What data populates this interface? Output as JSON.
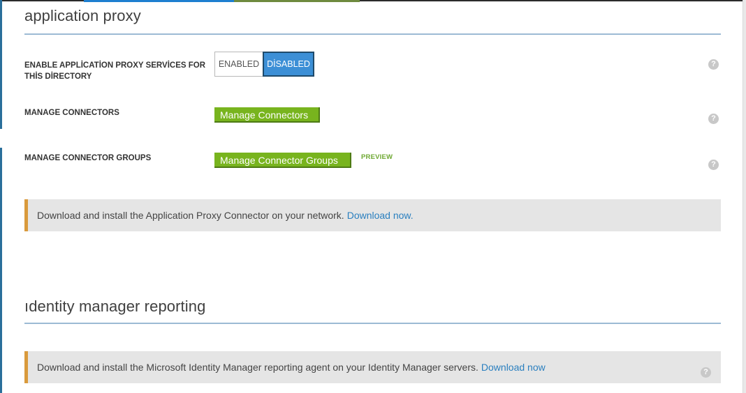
{
  "application_proxy": {
    "title": "application proxy",
    "enable_row": {
      "label": "ENABLE APPLİCATİON PROXY SERVİCES FOR THİS DİRECTORY",
      "option_enabled": "ENABLED",
      "option_disabled": "DİSABLED",
      "selected": "DİSABLED"
    },
    "connectors_row": {
      "label": "MANAGE CONNECTORS",
      "button": "Manage Connectors"
    },
    "connector_groups_row": {
      "label": "MANAGE CONNECTOR GROUPS",
      "button": "Manage Connector Groups",
      "badge": "PREVIEW"
    },
    "banner": {
      "text": "Download and install the Application Proxy Connector on your network.",
      "link": "Download now."
    }
  },
  "identity_manager_reporting": {
    "title": "ıdentity manager reporting",
    "banner": {
      "text": "Download and install the Microsoft Identity Manager reporting agent on your Identity Manager servers.",
      "link": "Download now"
    }
  },
  "icons": {
    "help": "?"
  },
  "colors": {
    "accent_blue": "#3c8fd6",
    "button_green": "#78b41e",
    "banner_orange": "#d99a3c",
    "link_blue": "#2a7fbf",
    "preview_green": "#6ea832"
  }
}
